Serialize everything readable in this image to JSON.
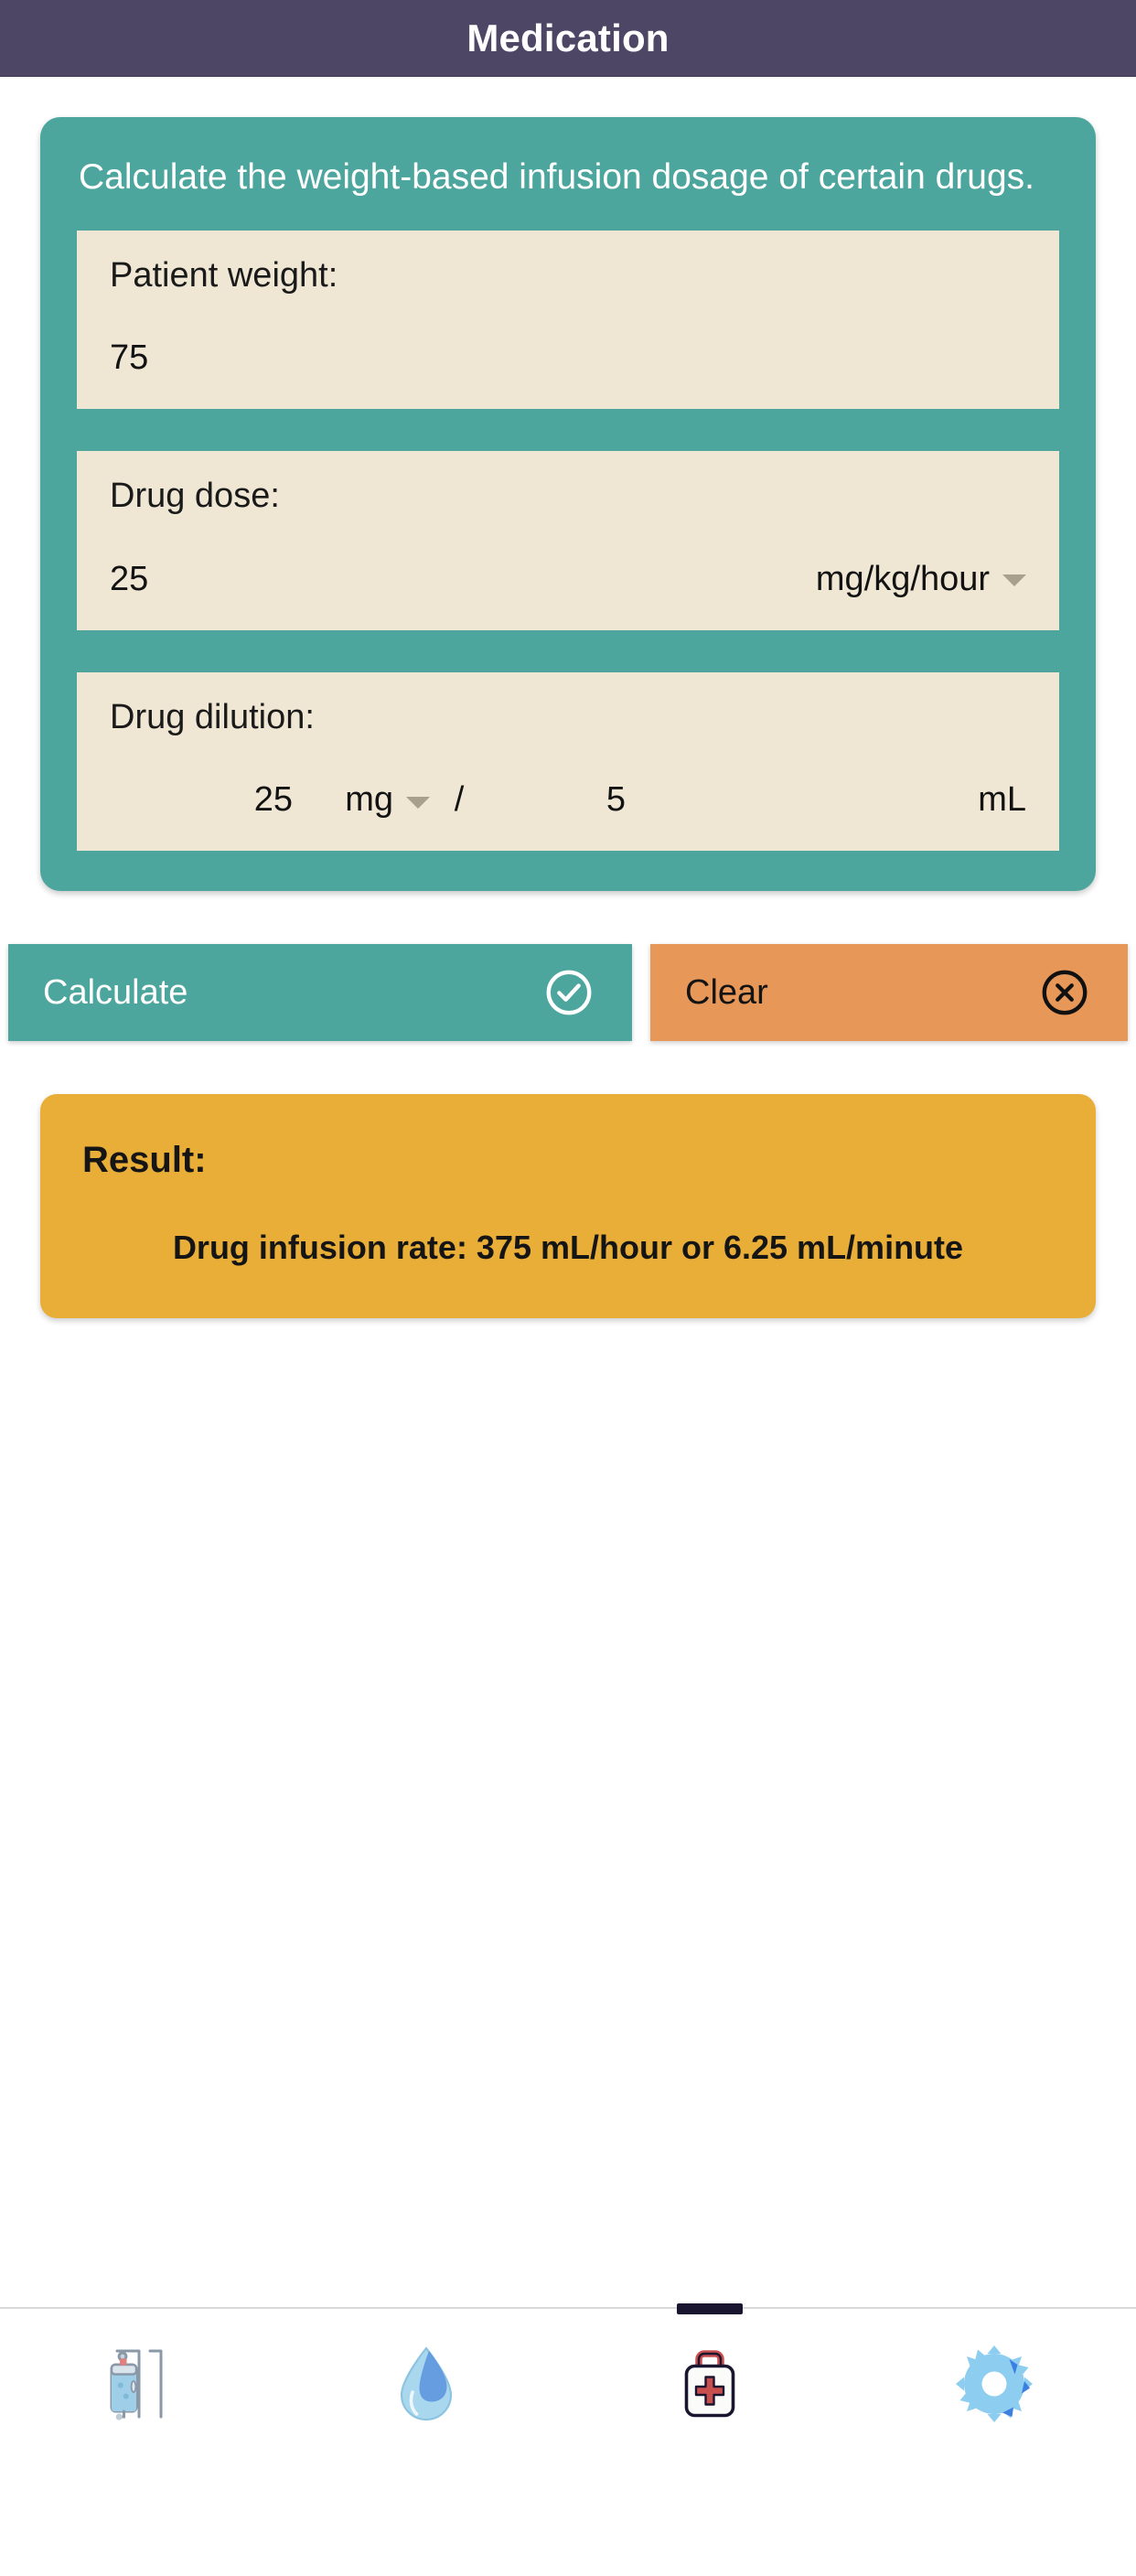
{
  "app": {
    "title": "Medication",
    "header_bg": "#4e4665",
    "card_bg": "#4da69e",
    "field_bg": "#efe7d4",
    "result_bg": "#e9ae38",
    "clear_bg": "#e79758"
  },
  "card": {
    "description": "Calculate the weight-based infusion dosage of certain drugs.",
    "patient_weight": {
      "label": "Patient weight:",
      "value": "75"
    },
    "drug_dose": {
      "label": "Drug dose:",
      "value": "25",
      "unit": "mg/kg/hour"
    },
    "drug_dilution": {
      "label": "Drug dilution:",
      "amount": "25",
      "amount_unit": "mg",
      "separator": "/",
      "volume": "5",
      "volume_unit": "mL"
    }
  },
  "buttons": {
    "calculate": {
      "label": "Calculate",
      "icon": "circle-check-icon"
    },
    "clear": {
      "label": "Clear",
      "icon": "circle-x-icon"
    }
  },
  "result": {
    "title": "Result:",
    "text": "Drug infusion rate: 375 mL/hour or 6.25 mL/minute"
  },
  "bottom_nav": {
    "items": [
      {
        "name": "iv-drip-icon",
        "active": false
      },
      {
        "name": "droplet-icon",
        "active": false
      },
      {
        "name": "first-aid-kit-icon",
        "active": true
      },
      {
        "name": "gear-icon",
        "active": false
      }
    ]
  }
}
